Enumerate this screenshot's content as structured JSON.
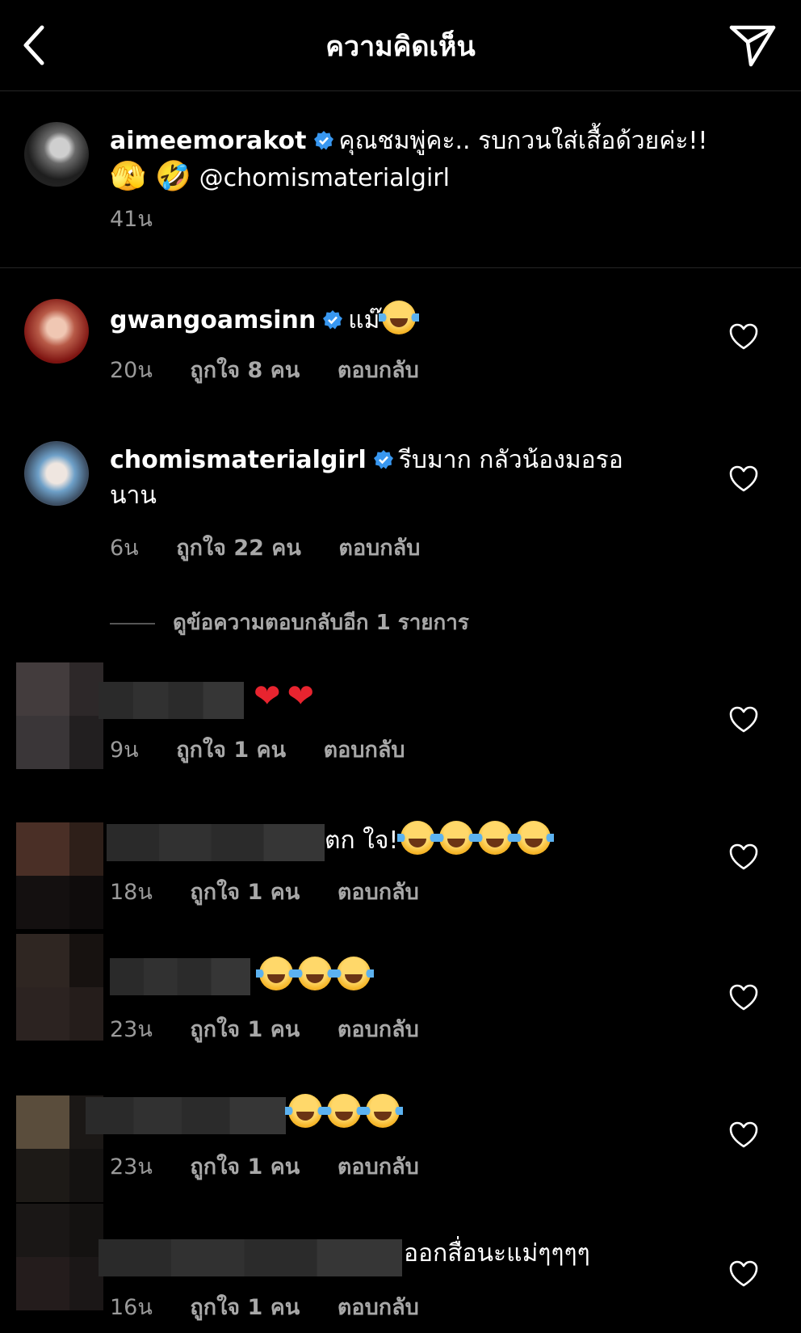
{
  "header": {
    "title": "ความคิดเห็น"
  },
  "caption": {
    "username": "aimeemorakot",
    "text_line1": "คุณชมพู่คะ.. รบกวนใส่เสื้อด้วยค่ะ!!",
    "emoji": "🫣 🤣",
    "mention": "@chomismaterialgirl",
    "time": "41น"
  },
  "comments": [
    {
      "username": "gwangoamsinn",
      "text": "แม๊",
      "time": "20น",
      "likes": "ถูกใจ 8 คน",
      "reply": "ตอบกลับ"
    },
    {
      "username": "chomismaterialgirl",
      "text_line1": "รีบมาก กลัวน้องมอรอ",
      "text_line2": "นาน",
      "time": "6น",
      "likes": "ถูกใจ 22 คน",
      "reply": "ตอบกลับ"
    },
    {
      "text": "",
      "time": "9น",
      "likes": "ถูกใจ 1 คน",
      "reply": "ตอบกลับ"
    },
    {
      "text": "ตก ใจ!",
      "time": "18น",
      "likes": "ถูกใจ 1 คน",
      "reply": "ตอบกลับ"
    },
    {
      "text": "",
      "time": "23น",
      "likes": "ถูกใจ 1 คน",
      "reply": "ตอบกลับ"
    },
    {
      "text": "",
      "time": "23น",
      "likes": "ถูกใจ 1 คน",
      "reply": "ตอบกลับ"
    },
    {
      "text": "ออกสื่อนะแม่ๆๆๆๆ",
      "time": "16น",
      "likes": "ถูกใจ 1 คน",
      "reply": "ตอบกลับ"
    }
  ],
  "view_replies": "ดูข้อความตอบกลับอีก 1 รายการ",
  "icons": {
    "back": "chevron-left-icon",
    "send": "paper-plane-icon",
    "verified": "verified-badge-icon",
    "like": "heart-outline-icon"
  },
  "colors": {
    "background": "#000000",
    "text": "#ffffff",
    "secondary_text": "#9a9a9a",
    "verified": "#3897f0",
    "divider": "#262626"
  }
}
